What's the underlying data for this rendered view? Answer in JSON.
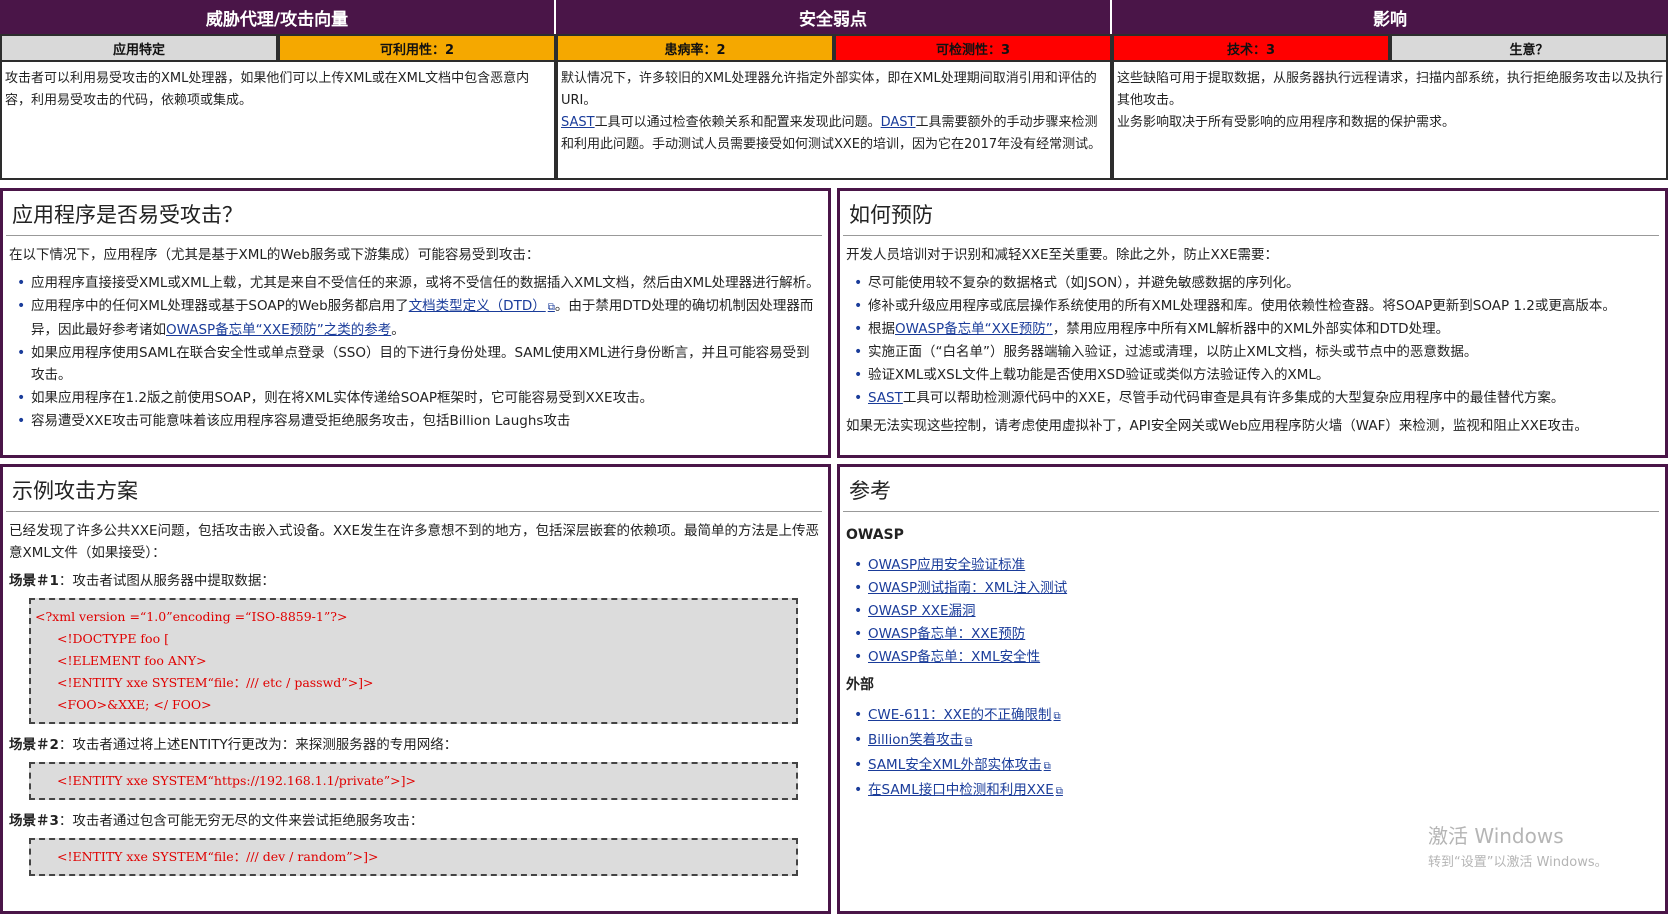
{
  "risk_table": {
    "headers": [
      "威胁代理/攻击向量",
      "安全弱点",
      "影响"
    ],
    "sub_headers": [
      "应用特定",
      "可利用性：2",
      "患病率：2",
      "可检测性：3",
      "技术：3",
      "生意？"
    ],
    "colors": {
      "header_bg": "#4a1548",
      "grey": "#d9d9d9",
      "orange": "#f5a800",
      "red": "#ff0000"
    },
    "desc_threat": "攻击者可以利用易受攻击的XML处理器，如果他们可以上传XML或在XML文档中包含恶意内容，利用易受攻击的代码，依赖项或集成。",
    "desc_weak_1": "默认情况下，许多较旧的XML处理器允许指定外部实体，即在XML处理期间取消引用和评估的URI。",
    "desc_weak_sast": "SAST",
    "desc_weak_2": "工具可以通过检查依赖关系和配置来发现此问题。",
    "desc_weak_dast": "DAST",
    "desc_weak_3": "工具需要额外的手动步骤来检测和利用此问题。手动测试人员需要接受如何测试XXE的培训，因为它在2017年没有经常测试。",
    "desc_impact_1": "这些缺陷可用于提取数据，从服务器执行远程请求，扫描内部系统，执行拒绝服务攻击以及执行其他攻击。",
    "desc_impact_2": "业务影响取决于所有受影响的应用程序和数据的保护需求。"
  },
  "vuln": {
    "title": "应用程序是否易受攻击？",
    "intro": "在以下情况下，应用程序（尤其是基于XML的Web服务或下游集成）可能容易受到攻击：",
    "item1": "应用程序直接接受XML或XML上载，尤其是来自不受信任的来源，或将不受信任的数据插入XML文档，然后由XML处理器进行解析。",
    "item2_a": "应用程序中的任何XML处理器或基于SOAP的Web服务都启用了",
    "item2_link1": "文档类型定义（DTD）",
    "item2_b": "。由于禁用DTD处理的确切机制因处理器而异，因此最好参考诸如",
    "item2_link2": "OWASP备忘单“XXE预防”之类的参考",
    "item2_c": "。",
    "item3": "如果应用程序使用SAML在联合安全性或单点登录（SSO）目的下进行身份处理。SAML使用XML进行身份断言，并且可能容易受到攻击。",
    "item4": "如果应用程序在1.2版之前使用SOAP，则在将XML实体传递给SOAP框架时，它可能容易受到XXE攻击。",
    "item5": "容易遭受XXE攻击可能意味着该应用程序容易遭受拒绝服务攻击，包括Billion Laughs攻击"
  },
  "prevent": {
    "title": "如何预防",
    "intro": "开发人员培训对于识别和减轻XXE至关重要。除此之外，防止XXE需要：",
    "item1": "尽可能使用较不复杂的数据格式（如JSON），并避免敏感数据的序列化。",
    "item2": "修补或升级应用程序或底层操作系统使用的所有XML处理器和库。使用依赖性检查器。将SOAP更新到SOAP 1.2或更高版本。",
    "item3_a": "根据",
    "item3_link": "OWASP备忘单“XXE预防”",
    "item3_b": "，禁用应用程序中所有XML解析器中的XML外部实体和DTD处理。",
    "item4": "实施正面（“白名单”）服务器端输入验证，过滤或清理，以防止XML文档，标头或节点中的恶意数据。",
    "item5": "验证XML或XSL文件上载功能是否使用XSD验证或类似方法验证传入的XML。",
    "item6_link": "SAST",
    "item6_b": "工具可以帮助检测源代码中的XXE，尽管手动代码审查是具有许多集成的大型复杂应用程序中的最佳替代方案。",
    "outro": "如果无法实现这些控制，请考虑使用虚拟补丁，API安全网关或Web应用程序防火墙（WAF）来检测，监视和阻止XXE攻击。"
  },
  "example": {
    "title": "示例攻击方案",
    "intro": "已经发现了许多公共XXE问题，包括攻击嵌入式设备。XXE发生在许多意想不到的地方，包括深层嵌套的依赖项。最简单的方法是上传恶意XML文件（如果接受）：",
    "s1_label": "场景＃1",
    "s1_text": "：攻击者试图从服务器中提取数据：",
    "code1_line1": "<?xml version =“1.0”encoding =“ISO-8859-1”?>",
    "code1_line2": "<!DOCTYPE foo [",
    "code1_line3": "<!ELEMENT foo ANY>",
    "code1_line4": "<!ENTITY xxe SYSTEM“file：/// etc / passwd”>]>",
    "code1_line5": "<FOO>&XXE; </ FOO>",
    "s2_label": "场景＃2",
    "s2_text": "：攻击者通过将上述ENTITY行更改为：来探测服务器的专用网络：",
    "code2": "<!ENTITY xxe SYSTEM“https://192.168.1.1/private”>]>",
    "s3_label": "场景＃3",
    "s3_text": "：攻击者通过包含可能无穷无尽的文件来尝试拒绝服务攻击：",
    "code3": "<!ENTITY xxe SYSTEM“file：/// dev / random”>]>"
  },
  "refs": {
    "title": "参考",
    "owasp_head": "OWASP",
    "owasp": [
      "OWASP应用安全验证标准",
      "OWASP测试指南：XML注入测试",
      "OWASP XXE漏洞",
      "OWASP备忘单：XXE预防",
      "OWASP备忘单：XML安全性"
    ],
    "ext_head": "外部",
    "external": [
      "CWE-611：XXE的不正确限制",
      "Billion笑着攻击",
      "SAML安全XML外部实体攻击",
      "在SAML接口中检测和利用XXE"
    ]
  },
  "watermark": {
    "line1": "激活 Windows",
    "line2": "转到“设置”以激活 Windows。"
  }
}
